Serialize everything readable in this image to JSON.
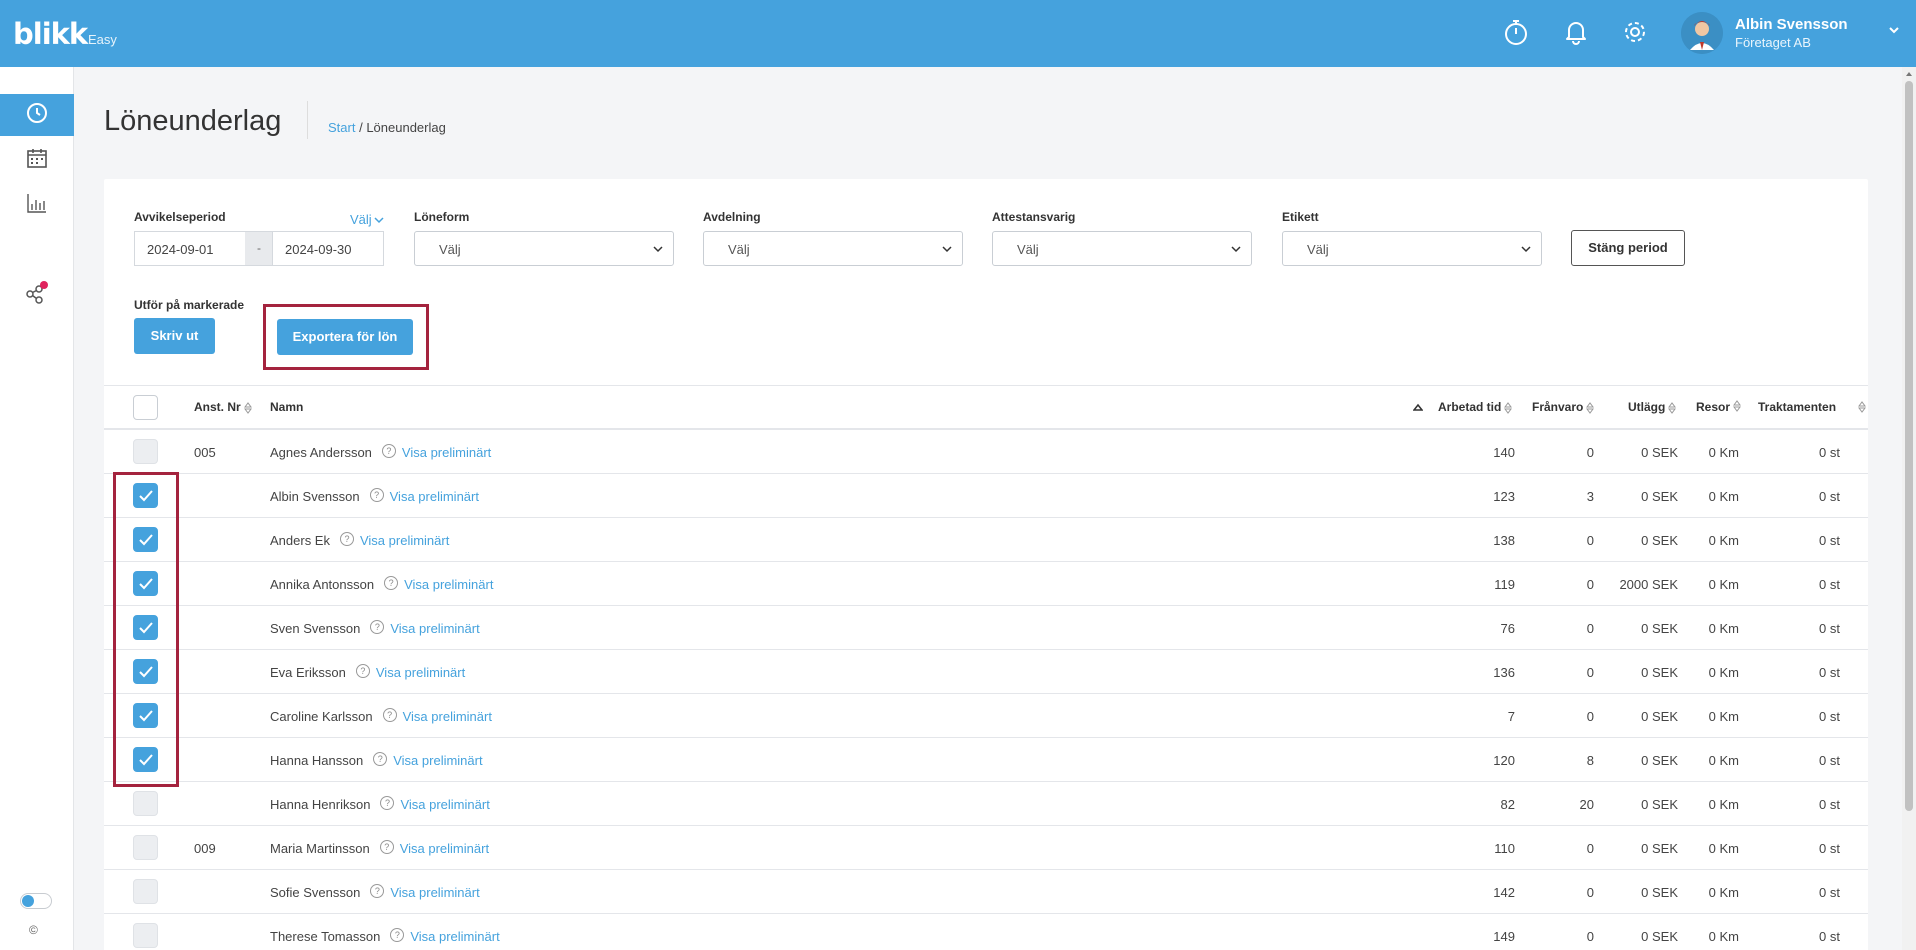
{
  "app": {
    "logo": "blikk",
    "logo_sub": "Easy"
  },
  "topbar": {
    "icons": [
      "stopwatch-icon",
      "bell-icon",
      "gear-icon"
    ],
    "user_name": "Albin Svensson",
    "user_company": "Företaget AB"
  },
  "sidebar": {
    "items": [
      "clock-icon",
      "calendar-icon",
      "bar-chart-icon",
      "share-icon"
    ],
    "copyright": "©"
  },
  "page": {
    "title": "Löneunderlag",
    "breadcrumb_start": "Start",
    "breadcrumb_sep": " / ",
    "breadcrumb_current": "Löneunderlag"
  },
  "filters": {
    "period_label": "Avvikelseperiod",
    "choose_link": "Välj",
    "date_from": "2024-09-01",
    "date_sep": "-",
    "date_to": "2024-09-30",
    "loneform_label": "Löneform",
    "loneform_value": "Välj",
    "avdelning_label": "Avdelning",
    "avdelning_value": "Välj",
    "attest_label": "Attestansvarig",
    "attest_value": "Välj",
    "etikett_label": "Etikett",
    "etikett_value": "Välj",
    "close_period": "Stäng period"
  },
  "actions": {
    "label": "Utför på markerade",
    "print": "Skriv ut",
    "export": "Exportera för lön"
  },
  "table": {
    "headers": {
      "anst_nr": "Anst. Nr",
      "namn": "Namn",
      "arbetad_tid": "Arbetad tid",
      "franvaro": "Frånvaro",
      "utlagg": "Utlägg",
      "resor": "Resor",
      "traktamenten": "Traktamenten"
    },
    "preliminary_label": "Visa preliminärt",
    "help_glyph": "?",
    "rows": [
      {
        "checked": false,
        "anst_nr": "005",
        "name": "Agnes Andersson",
        "worked": "140",
        "absence": "0",
        "expenses": "0 SEK",
        "travel": "0 Km",
        "allowances": "0 st"
      },
      {
        "checked": true,
        "anst_nr": "",
        "name": "Albin Svensson",
        "worked": "123",
        "absence": "3",
        "expenses": "0 SEK",
        "travel": "0 Km",
        "allowances": "0 st"
      },
      {
        "checked": true,
        "anst_nr": "",
        "name": "Anders Ek",
        "worked": "138",
        "absence": "0",
        "expenses": "0 SEK",
        "travel": "0 Km",
        "allowances": "0 st"
      },
      {
        "checked": true,
        "anst_nr": "",
        "name": "Annika Antonsson",
        "worked": "119",
        "absence": "0",
        "expenses": "2000 SEK",
        "travel": "0 Km",
        "allowances": "0 st"
      },
      {
        "checked": true,
        "anst_nr": "",
        "name": "Sven Svensson",
        "worked": "76",
        "absence": "0",
        "expenses": "0 SEK",
        "travel": "0 Km",
        "allowances": "0 st"
      },
      {
        "checked": true,
        "anst_nr": "",
        "name": "Eva Eriksson",
        "worked": "136",
        "absence": "0",
        "expenses": "0 SEK",
        "travel": "0 Km",
        "allowances": "0 st"
      },
      {
        "checked": true,
        "anst_nr": "",
        "name": "Caroline Karlsson",
        "worked": "7",
        "absence": "0",
        "expenses": "0 SEK",
        "travel": "0 Km",
        "allowances": "0 st"
      },
      {
        "checked": true,
        "anst_nr": "",
        "name": "Hanna Hansson",
        "worked": "120",
        "absence": "8",
        "expenses": "0 SEK",
        "travel": "0 Km",
        "allowances": "0 st"
      },
      {
        "checked": false,
        "anst_nr": "",
        "name": "Hanna Henrikson",
        "worked": "82",
        "absence": "20",
        "expenses": "0 SEK",
        "travel": "0 Km",
        "allowances": "0 st"
      },
      {
        "checked": false,
        "anst_nr": "009",
        "name": "Maria Martinsson",
        "worked": "110",
        "absence": "0",
        "expenses": "0 SEK",
        "travel": "0 Km",
        "allowances": "0 st"
      },
      {
        "checked": false,
        "anst_nr": "",
        "name": "Sofie Svensson",
        "worked": "142",
        "absence": "0",
        "expenses": "0 SEK",
        "travel": "0 Km",
        "allowances": "0 st"
      },
      {
        "checked": false,
        "anst_nr": "",
        "name": "Therese Tomasson",
        "worked": "149",
        "absence": "0",
        "expenses": "0 SEK",
        "travel": "0 Km",
        "allowances": "0 st"
      }
    ]
  },
  "colors": {
    "brand": "#45a2dd",
    "highlight": "#a4233e",
    "notification": "#e0245e"
  }
}
